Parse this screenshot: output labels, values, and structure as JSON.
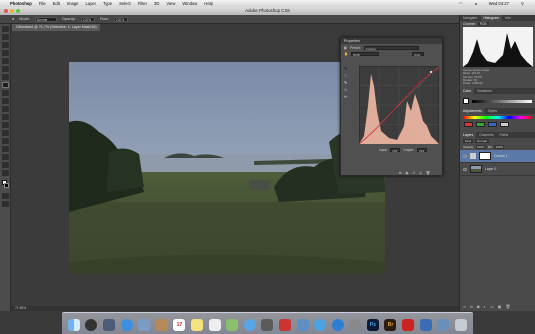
{
  "menubar": {
    "apple": "",
    "items": [
      "Photoshop",
      "File",
      "Edit",
      "Image",
      "Layer",
      "Type",
      "Select",
      "Filter",
      "3D",
      "View",
      "Window",
      "Help"
    ],
    "clock": "Wed 04:27"
  },
  "window": {
    "title": "Adobe Photoshop CS6"
  },
  "options_bar": {
    "mode_label": "Mode:",
    "mode_value": "Normal",
    "opacity_label": "Opacity:",
    "opacity_value": "100%",
    "flow_label": "Flow:",
    "flow_value": "100%"
  },
  "document": {
    "tab": "Clifordland @ 71.7% (Selective. 1, Layer Mask/16)",
    "status": "71.66%"
  },
  "properties": {
    "title": "Properties",
    "preset_label": "Preset:",
    "preset_value": "Custom",
    "channel_value": "RGB",
    "auto_label": "Auto",
    "input_label": "Input:",
    "input_value": "232",
    "output_label": "Output:",
    "output_value": "219"
  },
  "right_panel": {
    "top_tabs": [
      "Navigator",
      "Histogram",
      "Info"
    ],
    "histogram": {
      "channel_label": "Channel:",
      "channel_value": "RGB",
      "source_label": "Source:",
      "source_value": "Entire Image",
      "stats": [
        "Mean: 115.18",
        "Std Dev: 55.58",
        "Median: 96",
        "Pixels: 1195434"
      ]
    },
    "color_tabs": [
      "Color",
      "Swatches"
    ],
    "adjust_tabs": [
      "Adjustments",
      "Styles"
    ],
    "layers_tabs": [
      "Layers",
      "Channels",
      "Paths"
    ],
    "layers": {
      "kind_label": "Kind",
      "blend_value": "Normal",
      "opacity_label": "Opacity:",
      "opacity_value": "100%",
      "fill_label": "Fill:",
      "fill_value": "100%",
      "items": [
        {
          "name": "Curves 1"
        },
        {
          "name": "Layer 0"
        }
      ]
    }
  },
  "dock": {
    "icons": [
      "finder-icon",
      "dashboard-icon",
      "mission-control-icon",
      "safari-icon",
      "mail-icon",
      "contacts-icon",
      "calendar-icon",
      "notes-icon",
      "reminders-icon",
      "maps-icon",
      "messages-icon",
      "facetime-icon",
      "photo-booth-icon",
      "iphoto-icon",
      "itunes-icon",
      "app-store-icon",
      "system-preferences-icon",
      "photoshop-icon",
      "bridge-icon",
      "acrobat-icon",
      "finder-window-icon",
      "downloads-icon",
      "trash-icon"
    ],
    "labels": {
      "calendar": "17",
      "photoshop": "Ps",
      "bridge": "Br"
    }
  },
  "colors": {
    "accent": "#2b6fd4",
    "panel_bg": "#4a4a4a",
    "canvas_bg": "#3b3b3b"
  }
}
